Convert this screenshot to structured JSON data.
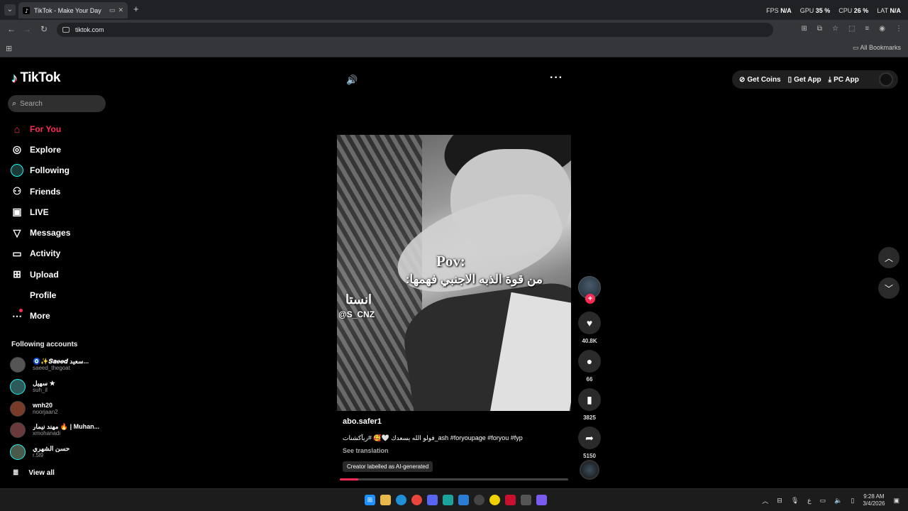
{
  "browser": {
    "tab_title": "TikTok - Make Your Day",
    "url": "tiktok.com",
    "all_bookmarks": "All Bookmarks",
    "osd": {
      "fps_label": "FPS",
      "fps_value": "N/A",
      "gpu_label": "GPU",
      "gpu_value": "35 %",
      "cpu_label": "CPU",
      "cpu_value": "26 %",
      "lat_label": "LAT",
      "lat_value": "N/A"
    }
  },
  "tiktok": {
    "logo": "TikTok",
    "search_placeholder": "Search",
    "nav": [
      {
        "label": "For You",
        "icon": "home-icon"
      },
      {
        "label": "Explore",
        "icon": "compass-icon"
      },
      {
        "label": "Following",
        "icon": "following-avatar-icon"
      },
      {
        "label": "Friends",
        "icon": "friends-icon"
      },
      {
        "label": "LIVE",
        "icon": "live-icon"
      },
      {
        "label": "Messages",
        "icon": "messages-icon"
      },
      {
        "label": "Activity",
        "icon": "activity-icon"
      },
      {
        "label": "Upload",
        "icon": "upload-icon"
      },
      {
        "label": "Profile",
        "icon": "profile-icon"
      },
      {
        "label": "More",
        "icon": "more-icon"
      }
    ],
    "following_title": "Following accounts",
    "following_accounts": [
      {
        "name": "🧿✨𝑺𝒂𝒆𝒆𝒅 سعيد...",
        "handle": "saeed_thegoat",
        "color": "#555"
      },
      {
        "name": "سهيل ★",
        "handle": "suh_il",
        "color": "#2f5a5a"
      },
      {
        "name": "wnh20",
        "handle": "noorjaan2",
        "color": "#7a3a2a"
      },
      {
        "name": "مهند نيمار 🔥 | Muhan...",
        "handle": "xmohanadi",
        "color": "#6a3a3a"
      },
      {
        "name": "حسن الشهري",
        "handle": "r.5l9",
        "color": "#4a5a4a"
      }
    ],
    "view_all": "View all",
    "top_right": {
      "coins": "Get Coins",
      "app": "Get App",
      "pc": "PC App"
    },
    "video": {
      "overlay_pov": "Pov:",
      "overlay_arabic": "من قوة الذبه الاجنبي فهمها:",
      "overlay_insta": "انستا",
      "overlay_handle": "@S_CNZ",
      "username": "abo.safer1",
      "caption": "فولو الله يسعدك 🤍🥰 #ريآكشنات_ash #foryoupage #foryou #fyp",
      "see_translation": "See translation",
      "ai_label": "Creator labelled as AI-generated",
      "progress": 0.08
    },
    "actions": {
      "likes": "40.8K",
      "comments": "66",
      "saves": "3825",
      "shares": "5150"
    }
  },
  "taskbar": {
    "time": "9:28 AM",
    "date": "3/4/2026",
    "lang": "ع"
  }
}
